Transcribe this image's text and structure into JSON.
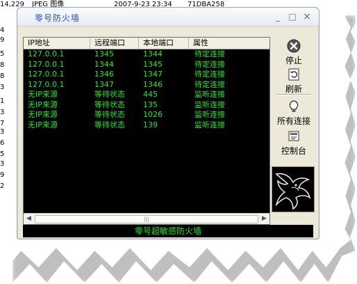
{
  "background_window": {
    "row": {
      "size": "14,229",
      "type": "JPEG 图像",
      "modified": "2007-9-23 23:34",
      "hash": "71DBA258"
    },
    "left_column": [
      "4",
      "9",
      "5",
      "8",
      "8",
      "3",
      "1",
      "3",
      "7",
      "3",
      "6",
      "5",
      "3",
      "9",
      "2"
    ]
  },
  "dialog": {
    "title": "零号防火墙",
    "minimize_glyph": "_",
    "maximize_glyph": "□",
    "close_glyph": "×"
  },
  "table": {
    "columns": [
      "IP地址",
      "远程端口",
      "本地端口",
      "属性"
    ],
    "rows": [
      [
        "127.0.0.1",
        "1345",
        "1344",
        "待定连接"
      ],
      [
        "127.0.0.1",
        "1344",
        "1345",
        "待定连接"
      ],
      [
        "127.0.0.1",
        "1346",
        "1347",
        "待定连接"
      ],
      [
        "127.0.0.1",
        "1347",
        "1346",
        "待定连接"
      ],
      [
        "无IP来源",
        "等待状态",
        "445",
        "监听连接"
      ],
      [
        "无IP来源",
        "等待状态",
        "135",
        "监听连接"
      ],
      [
        "无IP来源",
        "等待状态",
        "1026",
        "监听连接"
      ],
      [
        "无IP来源",
        "等待状态",
        "139",
        "监听连接"
      ]
    ],
    "text_color": "#22e822",
    "background": "#000000"
  },
  "toolbar": {
    "stop_label": "停止",
    "refresh_label": "刷新",
    "all_connections_label": "所有连接",
    "control_panel_label": "控制台"
  },
  "status": {
    "text": "零号超敏感防火墙"
  },
  "icons": [
    "stop-icon",
    "refresh-icon",
    "lightbulb-icon",
    "control-panel-icon",
    "dragon-logo-icon"
  ]
}
